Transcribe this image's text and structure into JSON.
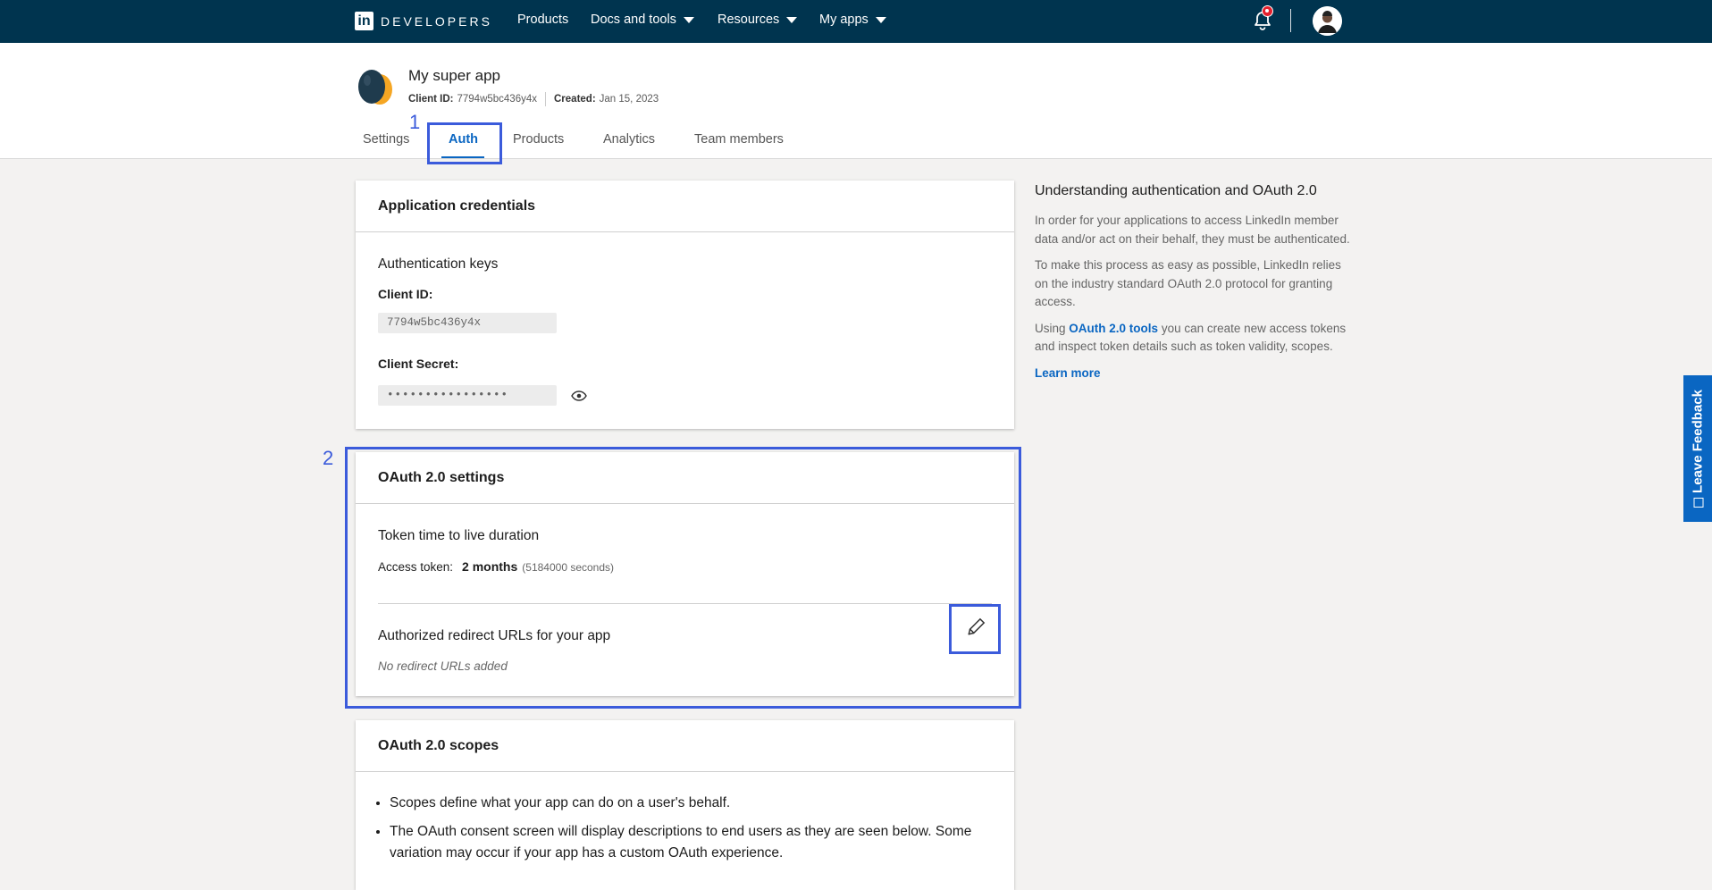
{
  "nav": {
    "brand": "DEVELOPERS",
    "items": [
      {
        "label": "Products"
      },
      {
        "label": "Docs and tools"
      },
      {
        "label": "Resources"
      },
      {
        "label": "My apps"
      }
    ]
  },
  "app": {
    "name": "My super app",
    "client_id_label": "Client ID:",
    "client_id": "7794w5bc436y4x",
    "created_label": "Created:",
    "created": "Jan 15, 2023"
  },
  "tabs": [
    {
      "label": "Settings"
    },
    {
      "label": "Auth",
      "active": true
    },
    {
      "label": "Products"
    },
    {
      "label": "Analytics"
    },
    {
      "label": "Team members"
    }
  ],
  "annotations": {
    "one": "1",
    "two": "2"
  },
  "credentials": {
    "title": "Application credentials",
    "keys_title": "Authentication keys",
    "client_id_label": "Client ID:",
    "client_id_value": "7794w5bc436y4x",
    "secret_label": "Client Secret:",
    "secret_value": "••••••••••••••••"
  },
  "oauth": {
    "title": "OAuth 2.0 settings",
    "ttl_title": "Token time to live duration",
    "access_label": "Access token:",
    "access_value": "2 months",
    "access_seconds": "(5184000 seconds)",
    "redirect_title": "Authorized redirect URLs for your app",
    "redirect_empty": "No redirect URLs added"
  },
  "scopes": {
    "title": "OAuth 2.0 scopes",
    "bullets": [
      "Scopes define what your app can do on a user's behalf.",
      "The OAuth consent screen will display descriptions to end users as they are seen below. Some variation may occur if your app has a custom OAuth experience."
    ]
  },
  "side": {
    "title": "Understanding authentication and OAuth 2.0",
    "p1": "In order for your applications to access LinkedIn member data and/or act on their behalf, they must be authenticated.",
    "p2": "To make this process as easy as possible, LinkedIn relies on the industry standard OAuth 2.0 protocol for granting access.",
    "p3_prefix": "Using",
    "p3_link": "OAuth 2.0 tools",
    "p3_suffix": "you can create new access tokens and inspect token details such as token validity, scopes.",
    "learn_more": "Learn more"
  },
  "feedback": {
    "label": "Leave Feedback"
  },
  "colors": {
    "nav_bg": "#00344f",
    "accent": "#0a66c2",
    "annotation": "#3b5bdb"
  }
}
